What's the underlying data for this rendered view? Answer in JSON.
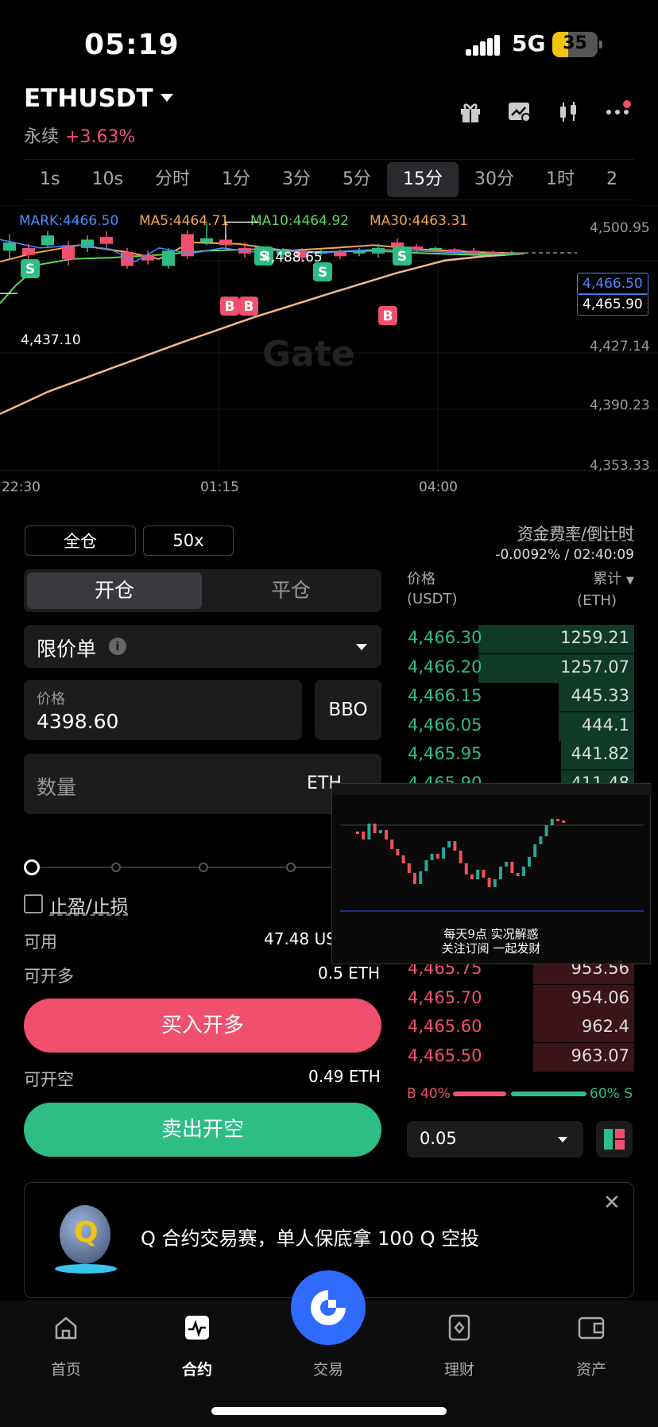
{
  "status_bar": {
    "time": "05:19",
    "network": "5G",
    "battery": "35",
    "battery_level": 0.35
  },
  "header": {
    "pair": "ETHUSDT",
    "contract_type": "永续",
    "change": "+3.63%"
  },
  "timeframes": [
    "1s",
    "10s",
    "分时",
    "1分",
    "3分",
    "5分",
    "15分",
    "30分",
    "1时",
    "2"
  ],
  "selected_timeframe": "15分",
  "chart": {
    "legend": {
      "mark": "MARK:4466.50",
      "ma5": "MA5:4464.71",
      "ma10": "MA10:4464.92",
      "ma30": "MA30:4463.31"
    },
    "y_ticks": [
      "4,500.95",
      "4,427.14",
      "4,390.23",
      "4,353.33"
    ],
    "x_ticks": [
      "22:30",
      "01:15",
      "04:00"
    ],
    "mark_price": "4,466.50",
    "last_price": "4,465.90",
    "low_label": "4,437.10",
    "high_label": "4,488.65",
    "watermark": "Gate",
    "colors": {
      "mark": "#4a8cff",
      "ma5": "#f4a64d",
      "ma10": "#5ed65a",
      "ma30": "#f2b98c",
      "up": "#2ebd85",
      "down": "#f0506e"
    }
  },
  "trade": {
    "margin_mode": "全仓",
    "leverage": "50x",
    "tabs": [
      "开仓",
      "平仓"
    ],
    "order_type": "限价单",
    "price_label": "价格",
    "price_value": "4398.60",
    "bbo": "BBO",
    "qty_placeholder": "数量",
    "qty_unit": "ETH",
    "tpsl": "止盈/止损",
    "available_label": "可用",
    "available_value": "47.48 US",
    "can_long_label": "可开多",
    "can_long_value": "0.5 ETH",
    "buy_button": "买入开多",
    "can_short_label": "可开空",
    "can_short_value": "0.49 ETH",
    "sell_button": "卖出开空"
  },
  "funding": {
    "label": "资金费率/倒计时",
    "value": "-0.0092% / 02:40:09"
  },
  "orderbook": {
    "price_header": "价格",
    "price_unit": "(USDT)",
    "total_header": "累计",
    "total_unit": "(ETH)",
    "bids": [
      {
        "price": "4,466.30",
        "total": "1259.21",
        "depth": 0.68
      },
      {
        "price": "4,466.20",
        "total": "1257.07",
        "depth": 0.68
      },
      {
        "price": "4,466.15",
        "total": "445.33",
        "depth": 0.33
      },
      {
        "price": "4,466.05",
        "total": "444.1",
        "depth": 0.33
      },
      {
        "price": "4,465.95",
        "total": "441.82",
        "depth": 0.32
      },
      {
        "price": "4,465.90",
        "total": "411.48",
        "depth": 0.32
      }
    ],
    "asks": [
      {
        "price": "4,465.75",
        "total": "953.56",
        "depth": 0.44
      },
      {
        "price": "4,465.70",
        "total": "954.06",
        "depth": 0.44
      },
      {
        "price": "4,465.60",
        "total": "962.4",
        "depth": 0.44
      },
      {
        "price": "4,465.50",
        "total": "963.07",
        "depth": 0.44
      }
    ],
    "buy_ratio": "B 40%",
    "sell_ratio": "60% S",
    "buy_share": 0.4,
    "precision": "0.05"
  },
  "video_overlay": {
    "line1": "每天9点 实况解惑",
    "line2": "关注订阅 一起发财"
  },
  "banner": {
    "text": "Q 合约交易赛，单人保底拿 100 Q 空投"
  },
  "nav": {
    "items": [
      "首页",
      "合约",
      "交易",
      "理财",
      "资产"
    ]
  }
}
